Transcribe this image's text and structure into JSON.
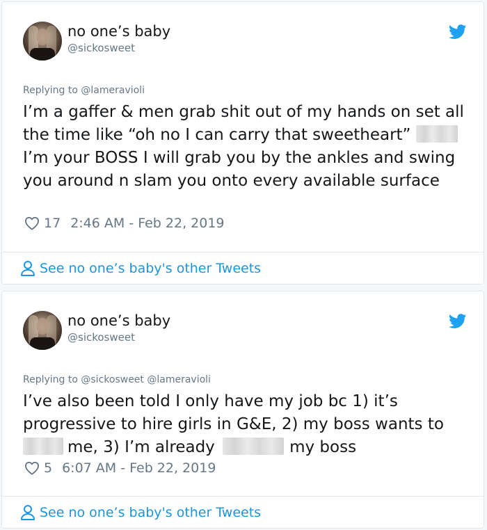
{
  "tweets": [
    {
      "display_name": "no one’s baby",
      "handle": "@sickosweet",
      "replying_prefix": "Replying to",
      "replying_to": "@lameravioli",
      "text": {
        "line1": "I’m a gaffer & men grab shit out of my hands on set all the time like “oh no I can carry that sweetheart”",
        "line2": "I’m your BOSS I will grab you by the ankles and swing you around n slam you onto every available surface"
      },
      "likes": "17",
      "timestamp": "2:46 AM - Feb 22, 2019",
      "footer_link": "See no one’s baby's other Tweets"
    },
    {
      "display_name": "no one’s baby",
      "handle": "@sickosweet",
      "replying_prefix": "Replying to",
      "replying_to": "@sickosweet @lameravioli",
      "text": {
        "part1": "I’ve also been told I only have my job bc 1) it’s progressive to hire girls in G&E, 2) my boss wants to",
        "part2": "me, 3) I’m already",
        "part3": "my boss"
      },
      "likes": "5",
      "timestamp": "6:07 AM - Feb 22, 2019",
      "footer_link": "See no one’s baby's other Tweets"
    }
  ],
  "colors": {
    "twitter_blue": "#1da1f2",
    "link_blue": "#1b95e0",
    "secondary_text": "#657786",
    "primary_text": "#14171a",
    "border": "#e1e8ed"
  },
  "icons": [
    "twitter-bird-icon",
    "heart-icon",
    "person-icon"
  ]
}
